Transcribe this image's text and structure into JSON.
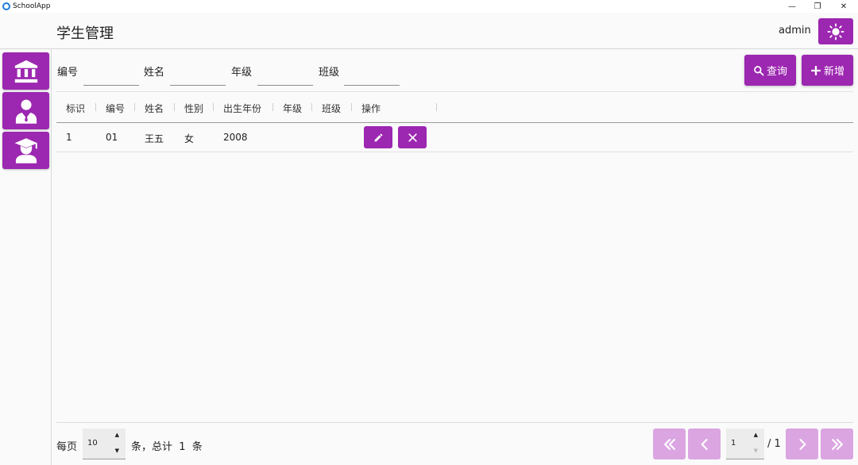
{
  "window": {
    "app_title": "SchoolApp",
    "minimize": "—",
    "maximize": "❐",
    "close": "✕"
  },
  "header": {
    "title": "学生管理",
    "username": "admin",
    "theme_icon": "sun-icon"
  },
  "sidebar": {
    "items": [
      {
        "icon": "school-building-icon"
      },
      {
        "icon": "teacher-icon"
      },
      {
        "icon": "student-graduate-icon"
      }
    ]
  },
  "filters": {
    "fields": [
      {
        "label": "编号",
        "value": ""
      },
      {
        "label": "姓名",
        "value": ""
      },
      {
        "label": "年级",
        "value": ""
      },
      {
        "label": "班级",
        "value": ""
      }
    ],
    "search_label": "查询",
    "add_label": "新增"
  },
  "table": {
    "columns": [
      "标识",
      "编号",
      "姓名",
      "性别",
      "出生年份",
      "年级",
      "班级",
      "操作"
    ],
    "rows": [
      {
        "id": "1",
        "code": "01",
        "name": "王五",
        "gender": "女",
        "birth_year": "2008",
        "grade": "",
        "class": ""
      }
    ]
  },
  "pagination": {
    "per_page_label": "每页",
    "per_page_value": "10",
    "total_text": "条，总计  1  条",
    "current_page": "1",
    "total_pages": "/ 1"
  },
  "colors": {
    "accent": "#9c27b0",
    "accent_disabled": "#dba5e2"
  }
}
